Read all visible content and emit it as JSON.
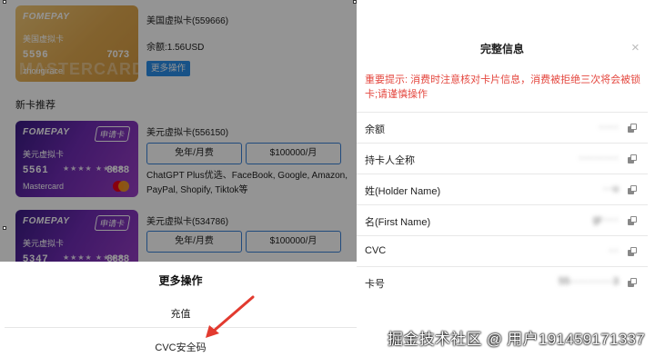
{
  "card1": {
    "brand": "FOMEPAY",
    "card_type": "美国虚拟卡",
    "number_start": "5596",
    "number_end": "7073",
    "holder": "zhougirace",
    "watermark": "MASTERCARD",
    "name": "美国虚拟卡(559666)",
    "balance": "余额:1.56USD",
    "more_button": "更多操作"
  },
  "section_title": "新卡推荐",
  "card2": {
    "brand": "FOMEPAY",
    "apply_tag": "申请卡",
    "card_type": "美元虚拟卡",
    "number_start": "5561",
    "stars": "★★★★ ★★★★",
    "number_end": "8888",
    "network": "Mastercard",
    "name": "美元虚拟卡(556150)",
    "fee_button": "免年/月费",
    "limit_button": "$100000/月",
    "features": "ChatGPT Plus优选、FaceBook, Google, Amazon, PayPal, Shopify, Tiktok等"
  },
  "card3": {
    "brand": "FOMEPAY",
    "apply_tag": "申请卡",
    "card_type": "美元虚拟卡",
    "number_start": "5347",
    "stars": "★★★★ ★★★★",
    "number_end": "8888",
    "name": "美元虚拟卡(534786)",
    "fee_button": "免年/月费",
    "limit_button": "$100000/月"
  },
  "sheet": {
    "title": "更多操作",
    "items": [
      "充值",
      "CVC安全码"
    ]
  },
  "panel": {
    "title": "完整信息",
    "close": "×",
    "warning": "重要提示: 消费时注意核对卡片信息，消费被拒绝三次将会被锁卡;请谨慎操作",
    "rows": [
      {
        "label": "余额",
        "value": "······"
      },
      {
        "label": "持卡人全称",
        "value": "············"
      },
      {
        "label": "姓(Holder Name)",
        "value": "···u"
      },
      {
        "label": "名(First Name)",
        "value": "gr·····"
      },
      {
        "label": "CVC",
        "value": "···"
      },
      {
        "label": "卡号",
        "value": "55·············3"
      }
    ]
  },
  "watermark": "掘金技术社区 @ 用户191459171337",
  "colors": {
    "accent": "#2a8de8",
    "warning": "#e4473f",
    "arrow": "#e23a2f"
  }
}
